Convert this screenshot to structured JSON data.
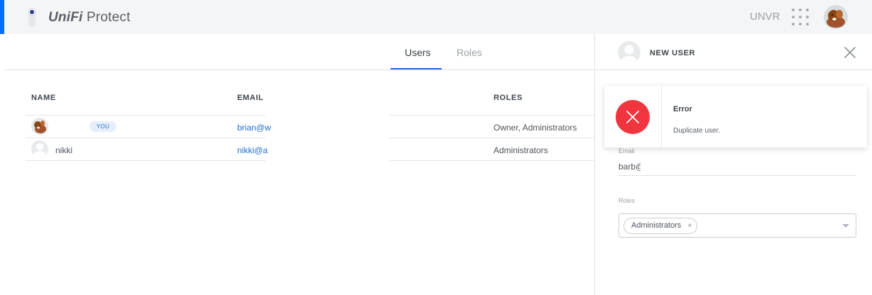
{
  "header": {
    "brand_unifi": "UniFi",
    "brand_product": "Protect",
    "device_name": "UNVR"
  },
  "tabs": [
    {
      "label": "Users",
      "active": true
    },
    {
      "label": "Roles",
      "active": false
    }
  ],
  "table": {
    "columns": [
      "NAME",
      "EMAIL",
      "ROLES"
    ],
    "rows": [
      {
        "name": "",
        "badge": "YOU",
        "email": "brian@w",
        "roles": "Owner, Administrators"
      },
      {
        "name": "nikki",
        "badge": "",
        "email": "nikki@a",
        "roles": "Administrators"
      }
    ]
  },
  "panel": {
    "title": "NEW USER",
    "email_label": "Email",
    "email_value": "barb@",
    "roles_label": "Roles",
    "roles_selected": "Administrators",
    "chip_remove": "×"
  },
  "toast": {
    "title": "Error",
    "message": "Duplicate user."
  },
  "colors": {
    "accent": "#1f6fd4",
    "brand_blue": "#006fff",
    "error": "#f0353f"
  },
  "icons": {
    "logo": "camera-icon",
    "apps": "grid-icon",
    "close": "close-icon",
    "error": "error-x-icon",
    "caret": "chevron-down-icon"
  }
}
